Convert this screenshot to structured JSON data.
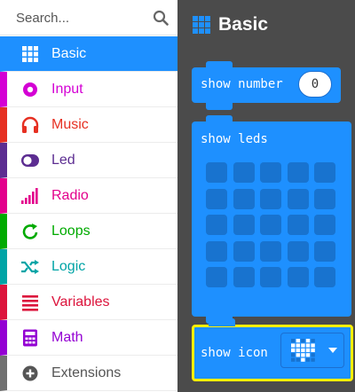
{
  "search": {
    "placeholder": "Search..."
  },
  "categories": [
    {
      "label": "Basic",
      "color": "#1e90ff",
      "icon": "grid-icon",
      "active": true
    },
    {
      "label": "Input",
      "color": "#d400d4",
      "icon": "input-icon",
      "active": false
    },
    {
      "label": "Music",
      "color": "#e63022",
      "icon": "headphones-icon",
      "active": false
    },
    {
      "label": "Led",
      "color": "#5c2d91",
      "icon": "toggle-icon",
      "active": false
    },
    {
      "label": "Radio",
      "color": "#e3008c",
      "icon": "signal-icon",
      "active": false
    },
    {
      "label": "Loops",
      "color": "#00aa00",
      "icon": "loop-icon",
      "active": false
    },
    {
      "label": "Logic",
      "color": "#00a4a6",
      "icon": "shuffle-icon",
      "active": false
    },
    {
      "label": "Variables",
      "color": "#dc143c",
      "icon": "list-icon",
      "active": false
    },
    {
      "label": "Math",
      "color": "#9400d3",
      "icon": "calculator-icon",
      "active": false
    },
    {
      "label": "Extensions",
      "color": "#717171",
      "icon": "plus-icon",
      "active": false
    }
  ],
  "flyout": {
    "title": "Basic",
    "blocks": {
      "show_number": {
        "label": "show number",
        "value": "0"
      },
      "show_leds": {
        "label": "show leds"
      },
      "show_icon": {
        "label": "show icon",
        "selected_icon": "heart-icon"
      }
    }
  }
}
